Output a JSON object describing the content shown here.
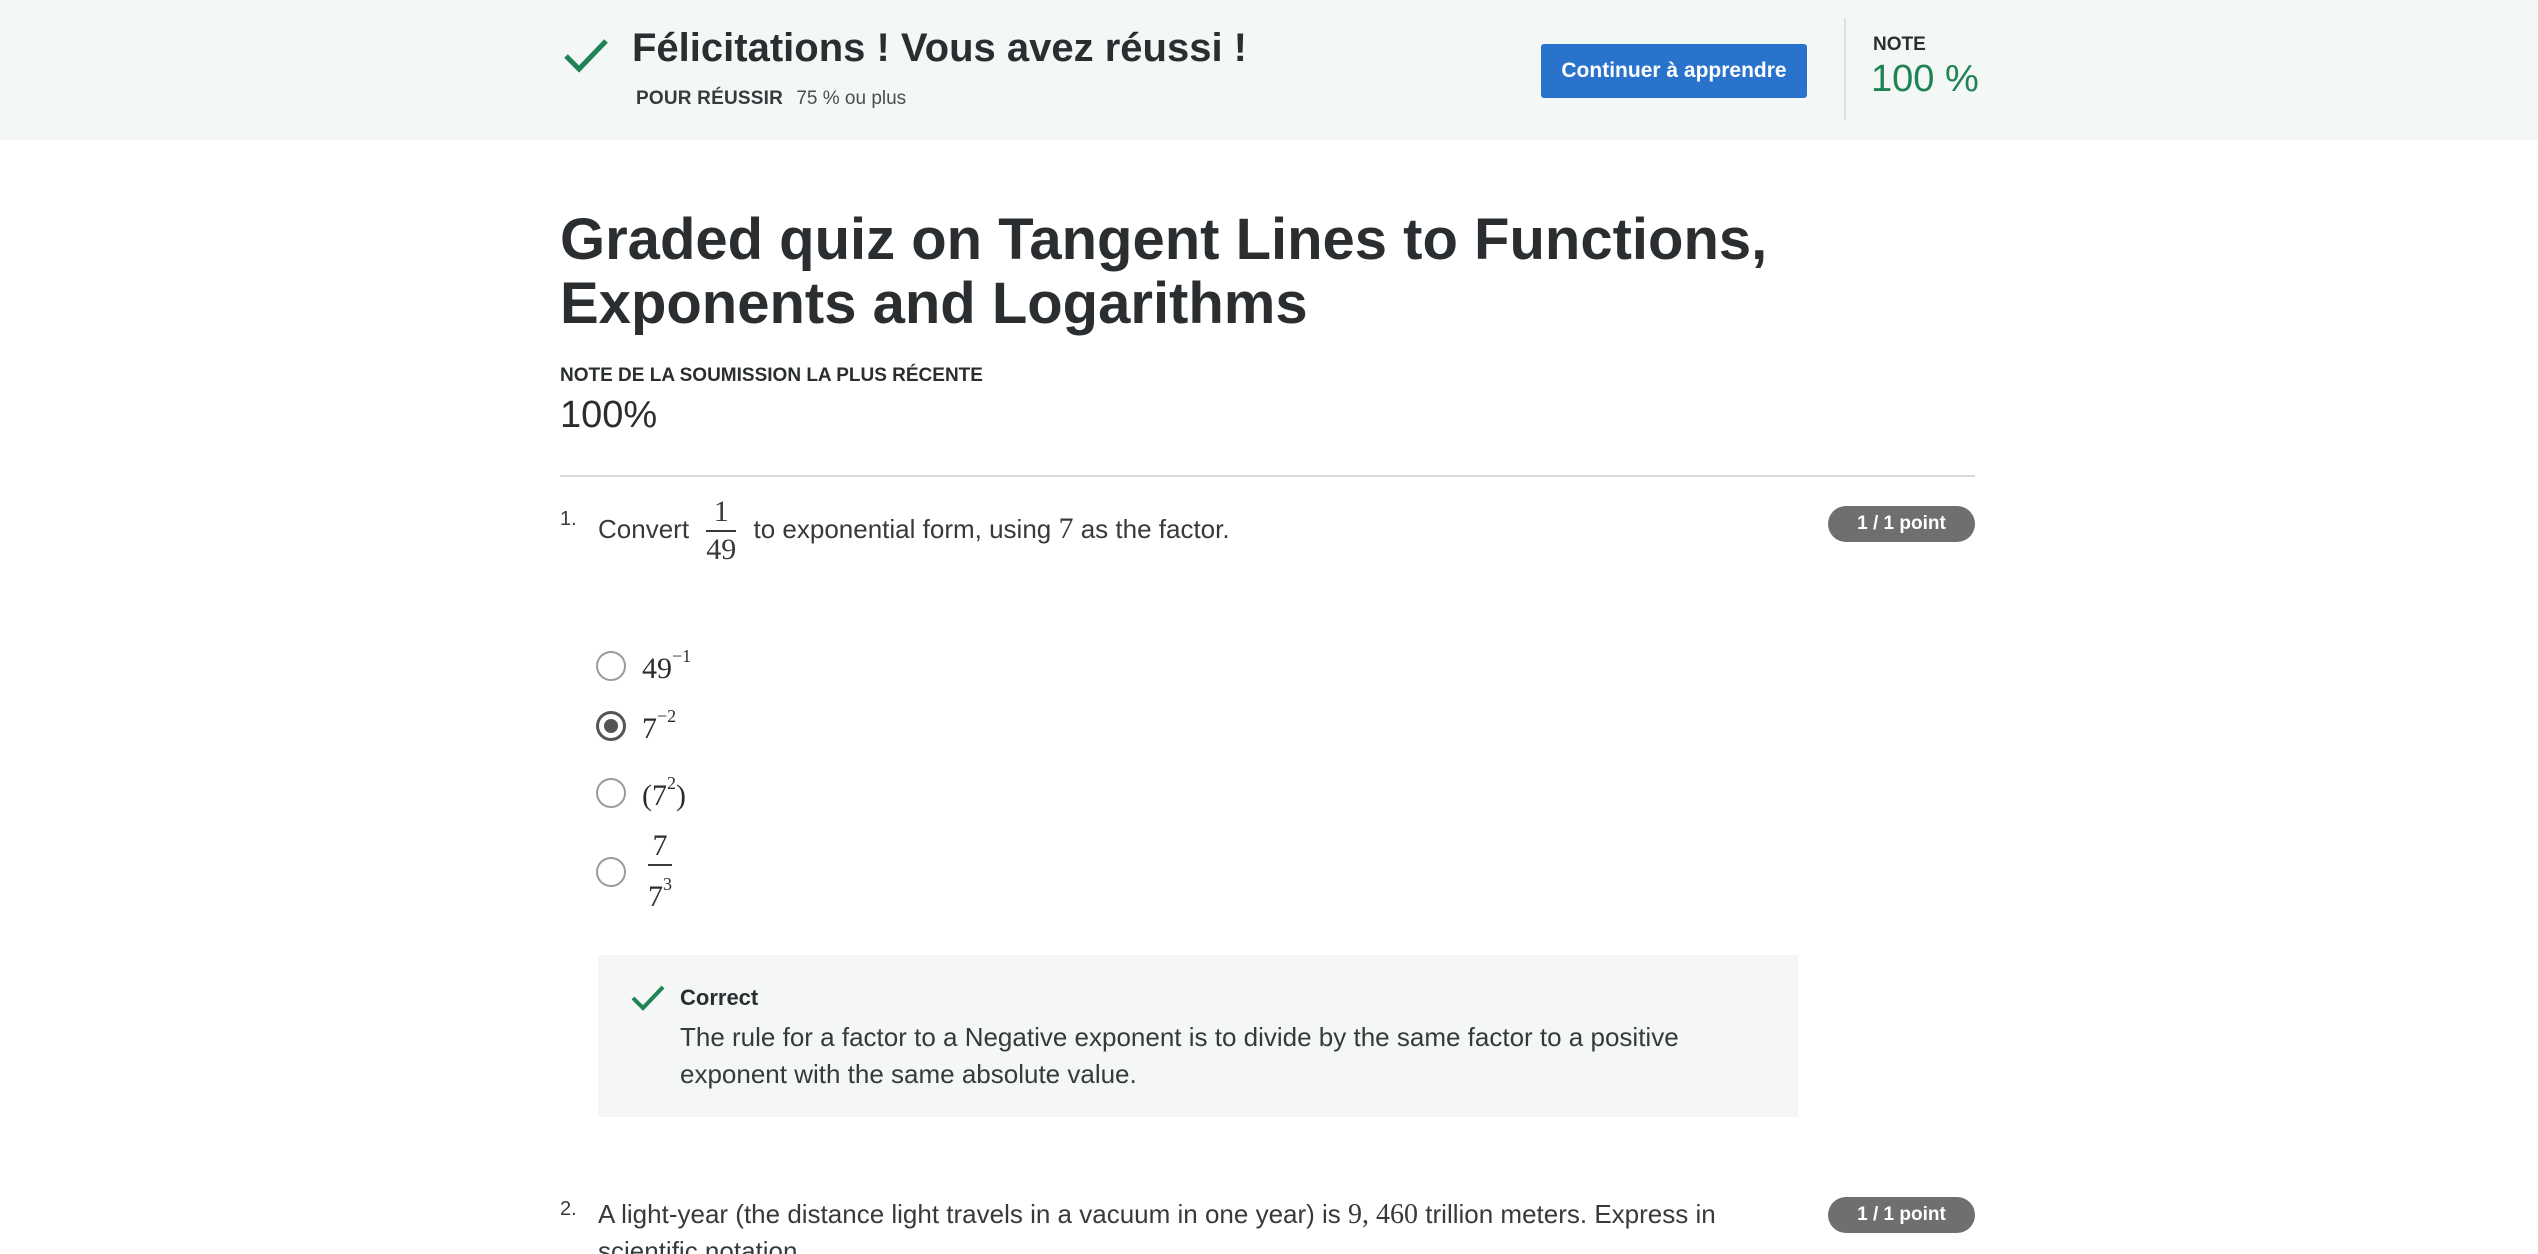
{
  "banner": {
    "title": "Félicitations ! Vous avez réussi !",
    "pass_label": "POUR RÉUSSIR",
    "pass_value": "75 % ou plus",
    "continue_label": "Continuer à apprendre",
    "grade_label": "NOTE",
    "grade_value": "100 %"
  },
  "quiz": {
    "title": "Graded quiz on Tangent Lines to Functions, Exponents and Logarithms",
    "recent_label": "NOTE DE LA SOUMISSION LA PLUS RÉCENTE",
    "recent_value": "100%"
  },
  "questions": [
    {
      "number": "1.",
      "text_before": "Convert",
      "fraction_num": "1",
      "fraction_den": "49",
      "text_middle": "to exponential form, using",
      "factor": "7",
      "text_after": "as the factor.",
      "points": "1 / 1 point",
      "options": [
        {
          "base": "49",
          "exp": "−1",
          "selected": false
        },
        {
          "base": "7",
          "exp": "−2",
          "selected": true
        },
        {
          "open": "(",
          "base": "7",
          "exp": "2",
          "close": ")",
          "selected": false
        },
        {
          "num": "7",
          "den_base": "7",
          "den_exp": "3",
          "selected": false
        }
      ],
      "feedback": {
        "title": "Correct",
        "text": "The rule for  a factor to a Negative exponent is to divide by the same factor to a positive exponent with the same absolute value."
      }
    },
    {
      "number": "2.",
      "text_before": "A light-year (the distance light travels in a vacuum in one year) is",
      "value": "9, 460",
      "text_after": "trillion meters. Express in scientific notation.",
      "points": "1 / 1 point"
    }
  ],
  "colors": {
    "banner_bg": "#f3f8f6",
    "success_green": "#1f8354",
    "button_blue": "#2a73cc",
    "points_badge": "#6f6f6f"
  }
}
